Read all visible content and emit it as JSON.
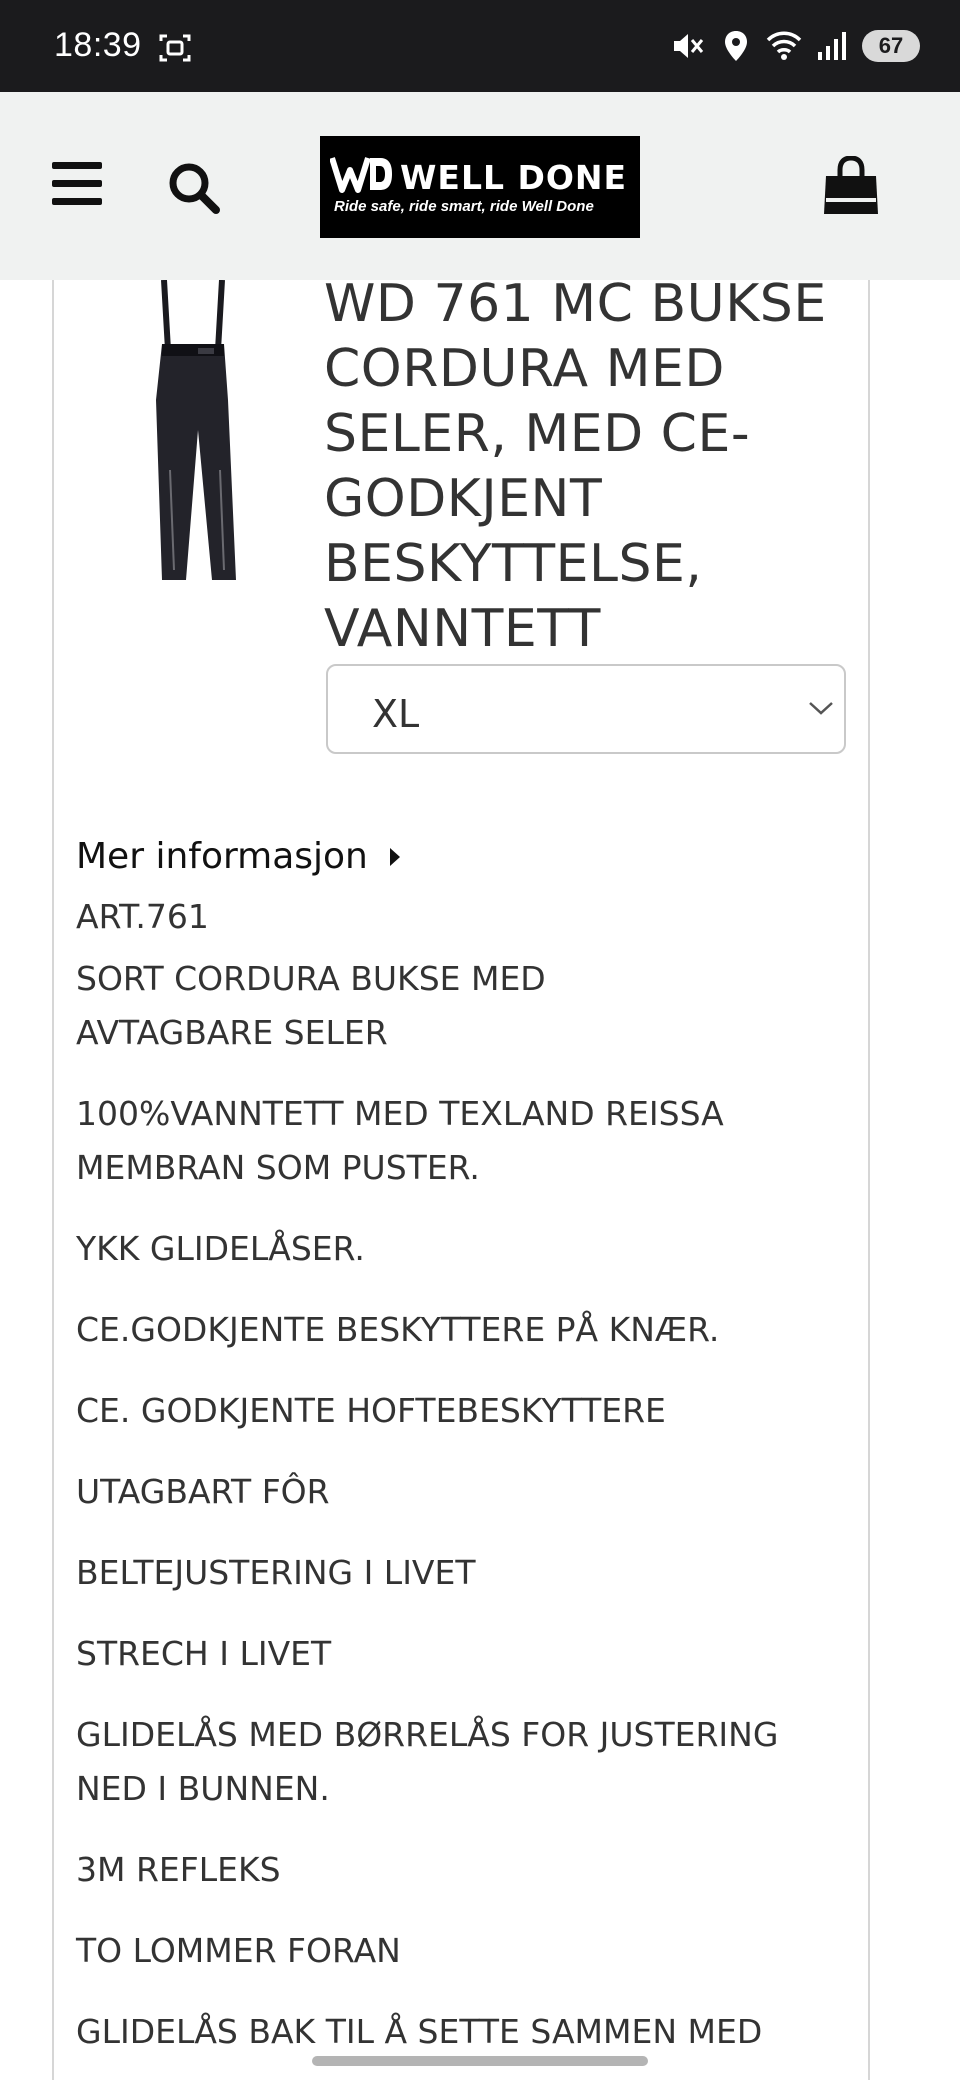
{
  "status_bar": {
    "time": "18:39",
    "battery": "67",
    "icons": [
      "screen-record-icon",
      "mute-icon",
      "location-icon",
      "wifi-icon",
      "signal-icon"
    ]
  },
  "header": {
    "logo": {
      "name": "WELL DONE",
      "tagline": "Ride safe, ride smart, ride Well Done"
    },
    "icons": [
      "menu-icon",
      "search-icon",
      "cart-icon"
    ]
  },
  "product": {
    "title": "WD 761 MC BUKSE CORDURA MED SELER, MED CE-GODKJENT BESKYTTELSE, VANNTETT",
    "size_selected": "XL",
    "more_info_label": "Mer informasjon",
    "description": [
      "ART.761",
      "SORT CORDURA BUKSE MED AVTAGBARE SELER",
      "100%VANNTETT MED TEXLAND REISSA MEMBRAN SOM PUSTER.",
      "YKK GLIDELÅSER.",
      "CE.GODKJENTE BESKYTTERE PÅ KNÆR.",
      "CE. GODKJENTE HOFTEBESKYTTERE",
      "UTAGBART FÔR",
      "BELTEJUSTERING I LIVET",
      "STRECH I LIVET",
      "GLIDELÅS MED BØRRELÅS FOR JUSTERING NED I BUNNEN.",
      "3M REFLEKS",
      "TO LOMMER FORAN",
      "GLIDELÅS BAK TIL Å SETTE SAMMEN MED"
    ]
  },
  "colors": {
    "status_bar_bg": "#1b1b1d",
    "header_bg": "#f0f2f1",
    "logo_bg": "#000000",
    "text": "#333333"
  }
}
